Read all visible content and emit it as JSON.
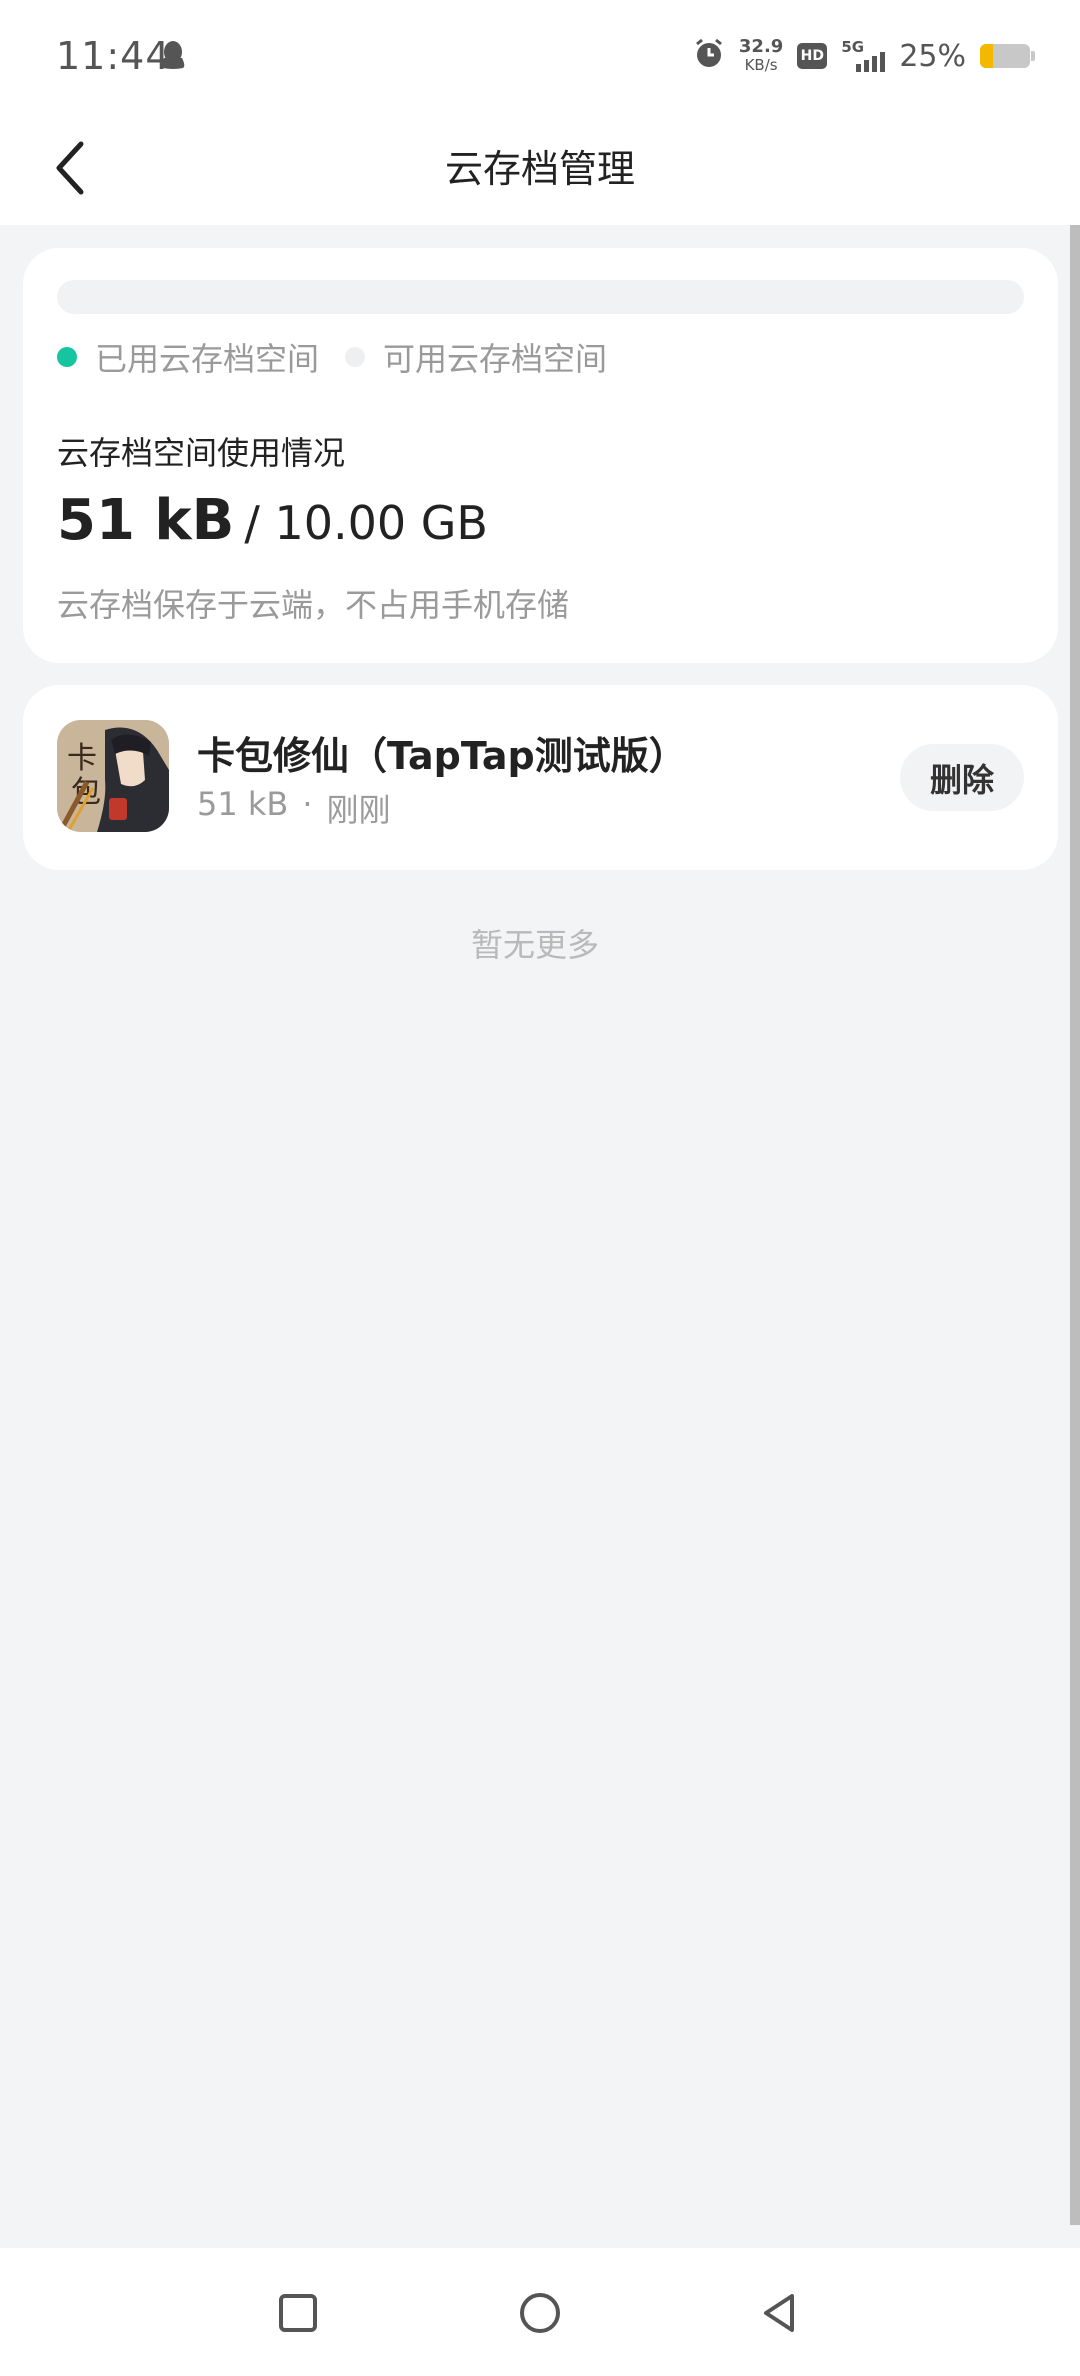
{
  "status_bar": {
    "time": "11:44",
    "net_speed": "32.9",
    "net_speed_unit": "KB/s",
    "hd": "HD",
    "network": "5G",
    "battery": "25%",
    "battery_level": 0.25,
    "icons": [
      "qq-icon",
      "alarm-icon",
      "hd-icon",
      "signal-icon",
      "battery-icon"
    ]
  },
  "header": {
    "title": "云存档管理",
    "back_icon": "chevron-left-icon"
  },
  "storage": {
    "legend_used": "已用云存档空间",
    "legend_available": "可用云存档空间",
    "title": "云存档空间使用情况",
    "used": "51 kB",
    "total": "/ 10.00 GB",
    "used_fraction": 5e-06,
    "note": "云存档保存于云端，不占用手机存储",
    "colors": {
      "used": "#15c5a0",
      "available": "#eeeff1"
    }
  },
  "saves": [
    {
      "name": "卡包修仙（TapTap测试版）",
      "size": "51 kB",
      "separator": "·",
      "time": "刚刚",
      "delete_label": "删除"
    }
  ],
  "list_footer": "暂无更多",
  "nav": {
    "icons": [
      "recent-apps-icon",
      "home-icon",
      "back-triangle-icon"
    ]
  }
}
